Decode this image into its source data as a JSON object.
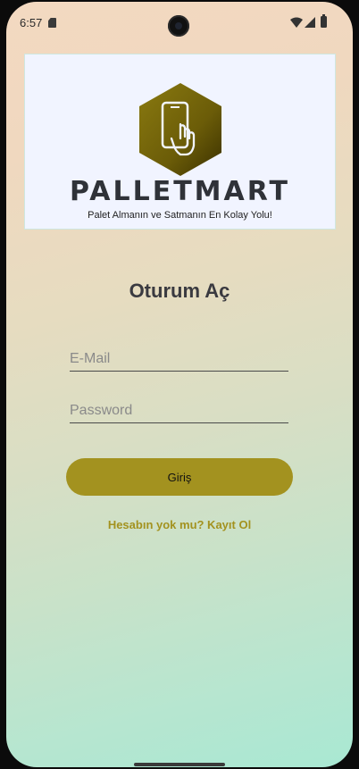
{
  "status_bar": {
    "time": "6:57",
    "icons": [
      "sd-card-icon",
      "wifi-icon",
      "signal-icon",
      "battery-icon"
    ]
  },
  "banner": {
    "brand": "PALLETMART",
    "tagline": "Palet Almanın ve Satmanın En Kolay Yolu!",
    "logo_color": "#7a6a0a"
  },
  "login": {
    "title": "Oturum Aç",
    "email_placeholder": "E-Mail",
    "password_placeholder": "Password",
    "submit_label": "Giriş",
    "register_link": "Hesabın yok mu? Kayıt Ol"
  },
  "colors": {
    "accent": "#a3921f",
    "title": "#3a3a40"
  }
}
